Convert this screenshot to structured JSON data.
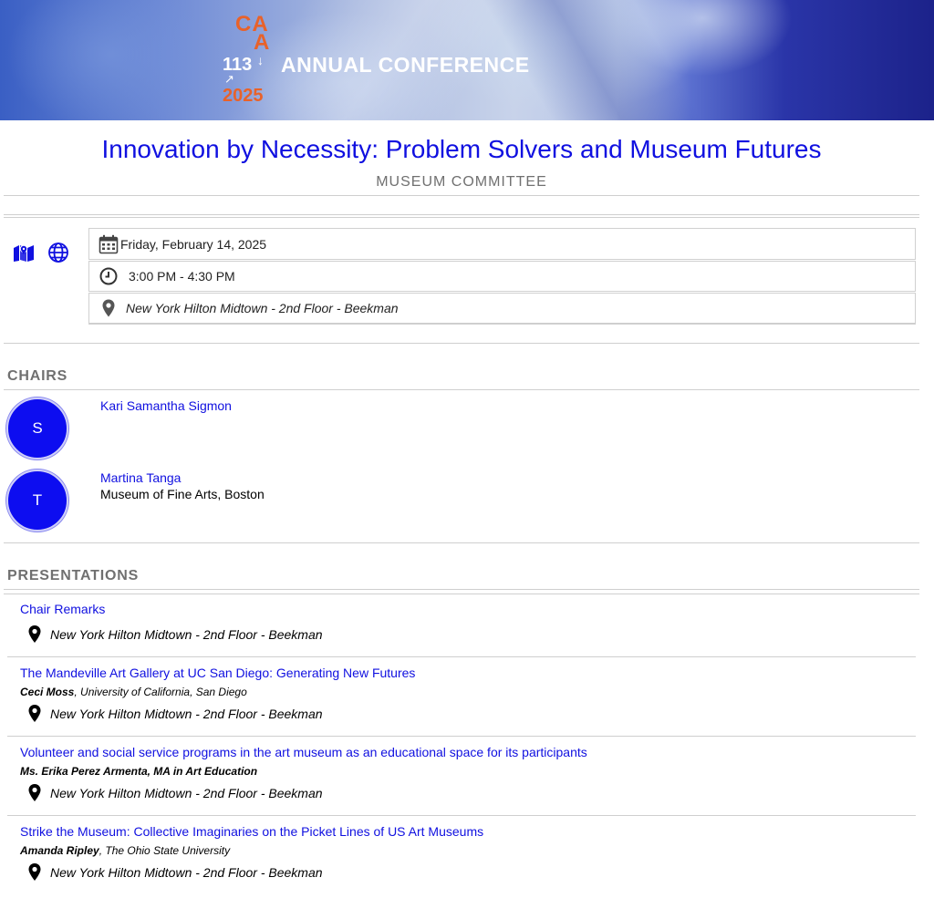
{
  "banner": {
    "logo": {
      "line1": "CA",
      "line2": "A",
      "number": "113",
      "year": "2025"
    },
    "title": "ANNUAL CONFERENCE"
  },
  "session": {
    "title": "Innovation by Necessity: Problem Solvers and Museum Futures",
    "subtitle": "MUSEUM COMMITTEE"
  },
  "info": {
    "date": "Friday, February 14, 2025",
    "time": "3:00 PM - 4:30 PM",
    "location": "New York Hilton Midtown - 2nd Floor - Beekman",
    "icons": [
      "map-icon",
      "globe-icon",
      "calendar-icon",
      "clock-icon",
      "location-pin-icon"
    ]
  },
  "chairs": {
    "heading": "CHAIRS",
    "items": [
      {
        "initial": "S",
        "name": "Kari Samantha Sigmon",
        "affiliation": ""
      },
      {
        "initial": "T",
        "name": "Martina Tanga",
        "affiliation": "Museum of Fine Arts, Boston"
      }
    ]
  },
  "presentations": {
    "heading": "PRESENTATIONS",
    "items": [
      {
        "title": "Chair Remarks",
        "author": "",
        "affiliation": "",
        "location": "New York Hilton Midtown - 2nd Floor - Beekman"
      },
      {
        "title": "The Mandeville Art Gallery at UC San Diego: Generating New Futures",
        "author": "Ceci Moss",
        "affiliation": ", University of California, San Diego",
        "location": "New York Hilton Midtown - 2nd Floor - Beekman"
      },
      {
        "title": "Volunteer and social service programs in the art museum as an educational space for its participants",
        "author": "Ms. Erika Perez Armenta, MA in Art Education",
        "affiliation": "",
        "location": "New York Hilton Midtown - 2nd Floor - Beekman"
      },
      {
        "title": "Strike the Museum: Collective Imaginaries on the Picket Lines of US Art Museums",
        "author": "Amanda Ripley",
        "affiliation": ", The Ohio State University",
        "location": "New York Hilton Midtown - 2nd Floor - Beekman"
      }
    ]
  },
  "colors": {
    "link": "#1010e0",
    "accent": "#e8622a",
    "avatar": "#0d0df0",
    "muted": "#707070"
  }
}
